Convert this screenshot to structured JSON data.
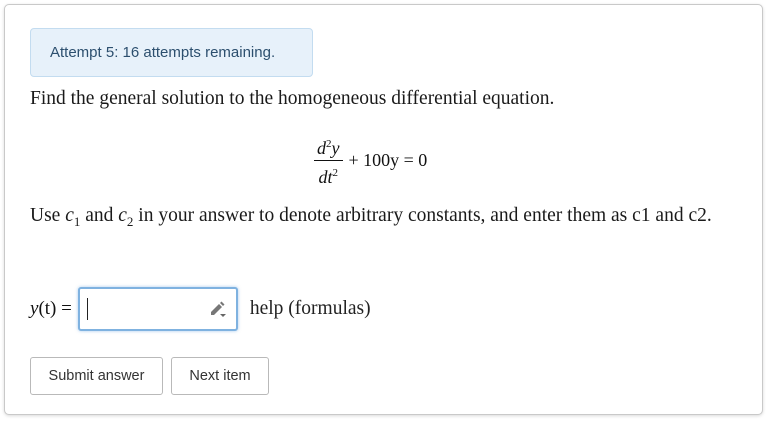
{
  "attempt_banner": {
    "text": "Attempt 5: 16 attempts remaining."
  },
  "question": {
    "prompt": "Find the general solution to the homogeneous differential equation.",
    "equation": {
      "numerator": "d",
      "numerator_power": "2",
      "numerator_var": "y",
      "denominator": "dt",
      "denominator_power": "2",
      "rest": "+ 100y = 0"
    },
    "instructions_part1": "Use ",
    "c1": "c",
    "c1_sub": "1",
    "instructions_and": " and ",
    "c2": "c",
    "c2_sub": "2",
    "instructions_part2": " in your answer to denote arbitrary constants, and enter them as c1 and c2."
  },
  "answer": {
    "label_func": "y",
    "label_arg": "(t)",
    "label_eq": " =",
    "input_value": "",
    "help_text": "help (formulas)"
  },
  "buttons": {
    "submit_label": "Submit answer",
    "next_label": "Next item"
  },
  "colors": {
    "banner_bg": "#e7f1fa",
    "banner_border": "#c3dcf0",
    "input_focus": "#7fb2e0"
  },
  "icons": {
    "edit": "pencil-edit-icon"
  }
}
